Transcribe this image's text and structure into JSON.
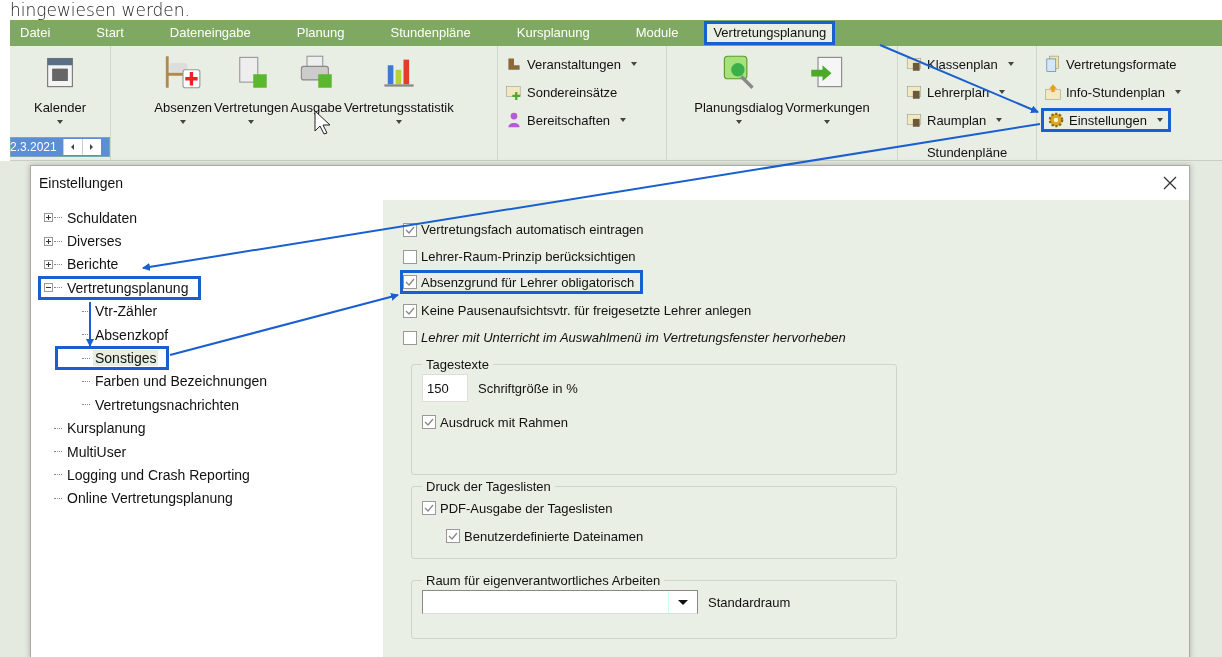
{
  "caption": "hingewiesen werden.",
  "ribbon": {
    "tabs": [
      {
        "label": "Datei",
        "selected": false,
        "highlighted": false
      },
      {
        "label": "Start",
        "selected": false,
        "highlighted": false
      },
      {
        "label": "Dateneingabe",
        "selected": false,
        "highlighted": false
      },
      {
        "label": "Planung",
        "selected": false,
        "highlighted": false
      },
      {
        "label": "Stundenpläne",
        "selected": false,
        "highlighted": false
      },
      {
        "label": "Kursplanung",
        "selected": false,
        "highlighted": false
      },
      {
        "label": "Module",
        "selected": false,
        "highlighted": false
      },
      {
        "label": "Vertretungsplanung",
        "selected": true,
        "highlighted": true
      }
    ],
    "groups": [
      {
        "kind": "large",
        "date_field": "2.3.2021",
        "items": [
          {
            "label": "Kalender",
            "has_menu": true,
            "highlighted": false
          }
        ]
      },
      {
        "kind": "large",
        "items": [
          {
            "label": "Absenzen",
            "has_menu": true,
            "highlighted": false
          },
          {
            "label": "Vertretungen",
            "has_menu": true,
            "highlighted": false
          },
          {
            "label": "Ausgabe",
            "has_menu": false,
            "highlighted": false
          },
          {
            "label": "Vertretungsstatistik",
            "has_menu": true,
            "highlighted": false
          }
        ]
      },
      {
        "kind": "small",
        "items": [
          {
            "label": "Veranstaltungen",
            "has_menu": true,
            "highlighted": false
          },
          {
            "label": "Sondereinsätze",
            "has_menu": false,
            "highlighted": false
          },
          {
            "label": "Bereitschaften",
            "has_menu": true,
            "highlighted": false
          }
        ]
      },
      {
        "kind": "large",
        "items": [
          {
            "label": "Planungsdialog",
            "has_menu": true,
            "highlighted": false
          },
          {
            "label": "Vormerkungen",
            "has_menu": true,
            "highlighted": false
          }
        ]
      },
      {
        "kind": "small",
        "label": "Stundenpläne",
        "items": [
          {
            "label": "Klassenplan",
            "has_menu": true,
            "highlighted": false
          },
          {
            "label": "Lehrerplan",
            "has_menu": true,
            "highlighted": false
          },
          {
            "label": "Raumplan",
            "has_menu": true,
            "highlighted": false
          }
        ]
      },
      {
        "kind": "small",
        "items": [
          {
            "label": "Vertretungsformate",
            "has_menu": false,
            "highlighted": false
          },
          {
            "label": "Info-Stundenplan",
            "has_menu": true,
            "highlighted": false
          },
          {
            "label": "Einstellungen",
            "has_menu": true,
            "highlighted": true
          }
        ]
      }
    ]
  },
  "dialog": {
    "title": "Einstellungen",
    "tree": [
      {
        "label": "Schuldaten",
        "kind": "node",
        "expanded": false,
        "selected": false,
        "highlighted": false
      },
      {
        "label": "Diverses",
        "kind": "node",
        "expanded": false,
        "selected": false,
        "highlighted": false
      },
      {
        "label": "Berichte",
        "kind": "node",
        "expanded": false,
        "selected": false,
        "highlighted": false
      },
      {
        "label": "Vertretungsplanung",
        "kind": "node",
        "expanded": true,
        "selected": false,
        "highlighted": true,
        "children": [
          {
            "label": "Vtr-Zähler",
            "selected": false,
            "highlighted": false
          },
          {
            "label": "Absenzkopf",
            "selected": false,
            "highlighted": false
          },
          {
            "label": "Sonstiges",
            "selected": true,
            "highlighted": true
          },
          {
            "label": "Farben und Bezeichnungen",
            "selected": false,
            "highlighted": false
          },
          {
            "label": "Vertretungsnachrichten",
            "selected": false,
            "highlighted": false
          }
        ]
      },
      {
        "label": "Kursplanung",
        "kind": "leaf",
        "selected": false,
        "highlighted": false
      },
      {
        "label": "MultiUser",
        "kind": "leaf",
        "selected": false,
        "highlighted": false
      },
      {
        "label": "Logging und Crash Reporting",
        "kind": "leaf",
        "selected": false,
        "highlighted": false
      },
      {
        "label": "Online Vertretungsplanung",
        "kind": "leaf",
        "selected": false,
        "highlighted": false
      }
    ],
    "options": [
      {
        "label": "Vertretungsfach automatisch eintragen",
        "checked": true,
        "italic": false,
        "highlighted": false
      },
      {
        "label": "Lehrer-Raum-Prinzip berücksichtigen",
        "checked": false,
        "italic": false,
        "highlighted": false
      },
      {
        "label": "Absenzgrund für Lehrer obligatorisch",
        "checked": true,
        "italic": false,
        "highlighted": true
      },
      {
        "label": "Keine Pausenaufsichtsvtr. für freigesetzte Lehrer anlegen",
        "checked": true,
        "italic": false,
        "highlighted": false
      },
      {
        "label": "Lehrer mit Unterricht im Auswahlmenü im Vertretungsfenster hervorheben",
        "checked": false,
        "italic": true,
        "highlighted": false
      }
    ],
    "tagestexte": {
      "title": "Tagestexte",
      "font_size_value": "150",
      "font_size_label": "Schriftgröße in %",
      "options": [
        {
          "label": "Ausdruck mit Rahmen",
          "checked": true
        }
      ]
    },
    "druck": {
      "title": "Druck der Tageslisten",
      "options": [
        {
          "label": "PDF-Ausgabe der Tageslisten",
          "checked": true,
          "children": [
            {
              "label": "Benutzerdefinierte Dateinamen",
              "checked": true
            }
          ]
        }
      ]
    },
    "raum": {
      "title": "Raum für eigenverantwortliches Arbeiten",
      "dropdown_label": "Standardraum"
    }
  }
}
